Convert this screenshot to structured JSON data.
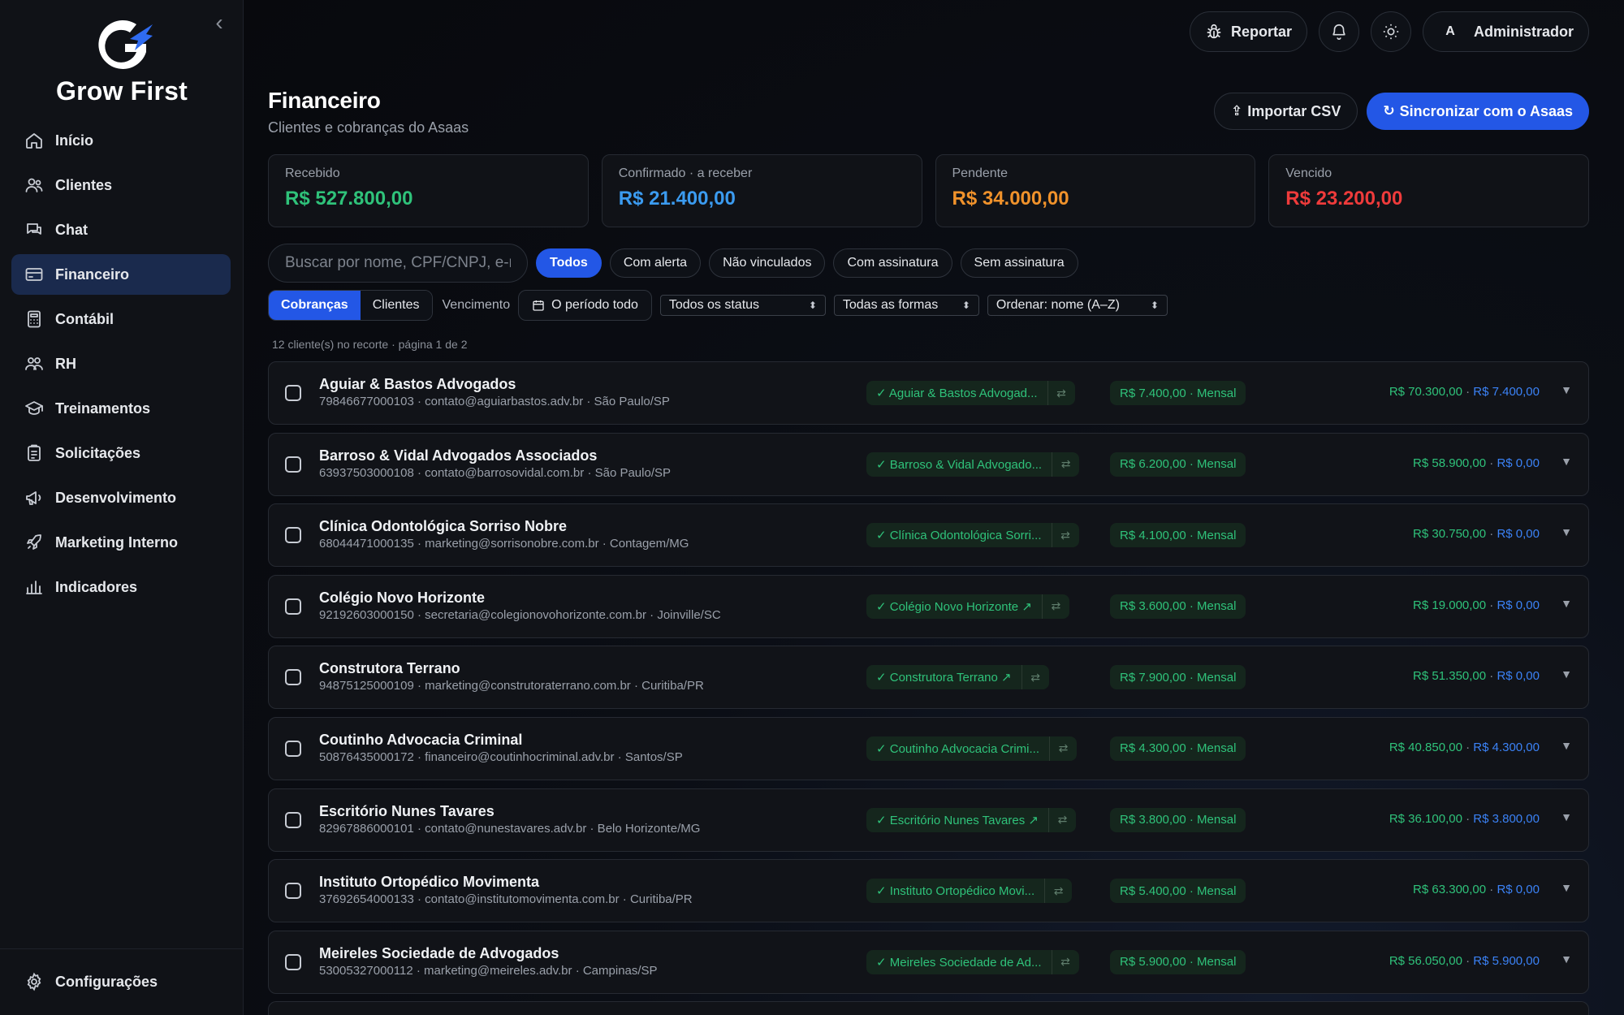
{
  "brand": {
    "name": "Grow First",
    "accent": "#2357e6"
  },
  "sidebar": {
    "items": [
      {
        "label": "Início",
        "icon": "home-icon",
        "active": false
      },
      {
        "label": "Clientes",
        "icon": "users-icon",
        "active": false
      },
      {
        "label": "Chat",
        "icon": "chat-icon",
        "active": false
      },
      {
        "label": "Financeiro",
        "icon": "credit-card-icon",
        "active": true
      },
      {
        "label": "Contábil",
        "icon": "calculator-icon",
        "active": false
      },
      {
        "label": "RH",
        "icon": "team-icon",
        "active": false
      },
      {
        "label": "Treinamentos",
        "icon": "graduation-cap-icon",
        "active": false
      },
      {
        "label": "Solicitações",
        "icon": "clipboard-icon",
        "active": false
      },
      {
        "label": "Desenvolvimento",
        "icon": "megaphone-icon",
        "active": false
      },
      {
        "label": "Marketing Interno",
        "icon": "rocket-icon",
        "active": false
      },
      {
        "label": "Indicadores",
        "icon": "bar-chart-icon",
        "active": false
      }
    ],
    "settings_label": "Configurações"
  },
  "topbar": {
    "report_label": "Reportar",
    "user_initial": "A",
    "user_name": "Administrador"
  },
  "header": {
    "title": "Financeiro",
    "subtitle": "Clientes e cobranças do Asaas",
    "import_label": "Importar CSV",
    "sync_label": "Sincronizar com o Asaas"
  },
  "stats": [
    {
      "label": "Recebido",
      "value": "R$ 527.800,00",
      "color": "#2fc27a"
    },
    {
      "label": "Confirmado · a receber",
      "value": "R$ 21.400,00",
      "color": "#3b9bf0"
    },
    {
      "label": "Pendente",
      "value": "R$ 34.000,00",
      "color": "#f0922b"
    },
    {
      "label": "Vencido",
      "value": "R$ 23.200,00",
      "color": "#ef3b3b"
    }
  ],
  "filters": {
    "search_placeholder": "Buscar por nome, CPF/CNPJ, e-mail",
    "chips": [
      "Todos",
      "Com alerta",
      "Não vinculados",
      "Com assinatura",
      "Sem assinatura"
    ],
    "view_tabs": [
      "Cobranças",
      "Clientes"
    ],
    "due_label": "Vencimento",
    "period": "O período todo",
    "status_select": "Todos os status",
    "method_select": "Todas as formas",
    "order_select": "Ordenar: nome (A–Z)"
  },
  "results_info": "12 cliente(s) no recorte · página 1 de 2",
  "rows": [
    {
      "name": "Aguiar & Bastos Advogados",
      "meta": "79846677000103 · contato@aguiarbastos.adv.br · São Paulo/SP",
      "link": "✓ Aguiar & Bastos Advogad...",
      "subscription": "R$ 7.400,00 · Mensal",
      "total": "R$ 70.300,00",
      "open": "R$ 7.400,00"
    },
    {
      "name": "Barroso & Vidal Advogados Associados",
      "meta": "63937503000108 · contato@barrosovidal.com.br · São Paulo/SP",
      "link": "✓ Barroso & Vidal Advogado...",
      "subscription": "R$ 6.200,00 · Mensal",
      "total": "R$ 58.900,00",
      "open": "R$ 0,00"
    },
    {
      "name": "Clínica Odontológica Sorriso Nobre",
      "meta": "68044471000135 · marketing@sorrisonobre.com.br · Contagem/MG",
      "link": "✓ Clínica Odontológica Sorri...",
      "subscription": "R$ 4.100,00 · Mensal",
      "total": "R$ 30.750,00",
      "open": "R$ 0,00"
    },
    {
      "name": "Colégio Novo Horizonte",
      "meta": "92192603000150 · secretaria@colegionovohorizonte.com.br · Joinville/SC",
      "link": "✓ Colégio Novo Horizonte ↗",
      "subscription": "R$ 3.600,00 · Mensal",
      "total": "R$ 19.000,00",
      "open": "R$ 0,00"
    },
    {
      "name": "Construtora Terrano",
      "meta": "94875125000109 · marketing@construtoraterrano.com.br · Curitiba/PR",
      "link": "✓ Construtora Terrano ↗",
      "subscription": "R$ 7.900,00 · Mensal",
      "total": "R$ 51.350,00",
      "open": "R$ 0,00"
    },
    {
      "name": "Coutinho Advocacia Criminal",
      "meta": "50876435000172 · financeiro@coutinhocriminal.adv.br · Santos/SP",
      "link": "✓ Coutinho Advocacia Crimi...",
      "subscription": "R$ 4.300,00 · Mensal",
      "total": "R$ 40.850,00",
      "open": "R$ 4.300,00"
    },
    {
      "name": "Escritório Nunes Tavares",
      "meta": "82967886000101 · contato@nunestavares.adv.br · Belo Horizonte/MG",
      "link": "✓ Escritório Nunes Tavares ↗",
      "subscription": "R$ 3.800,00 · Mensal",
      "total": "R$ 36.100,00",
      "open": "R$ 3.800,00"
    },
    {
      "name": "Instituto Ortopédico Movimenta",
      "meta": "37692654000133 · contato@institutomovimenta.com.br · Curitiba/PR",
      "link": "✓ Instituto Ortopédico Movi...",
      "subscription": "R$ 5.400,00 · Mensal",
      "total": "R$ 63.300,00",
      "open": "R$ 0,00"
    },
    {
      "name": "Meireles Sociedade de Advogados",
      "meta": "53005327000112 · marketing@meireles.adv.br · Campinas/SP",
      "link": "✓ Meireles Sociedade de Ad...",
      "subscription": "R$ 5.900,00 · Mensal",
      "total": "R$ 56.050,00",
      "open": "R$ 5.900,00"
    }
  ]
}
